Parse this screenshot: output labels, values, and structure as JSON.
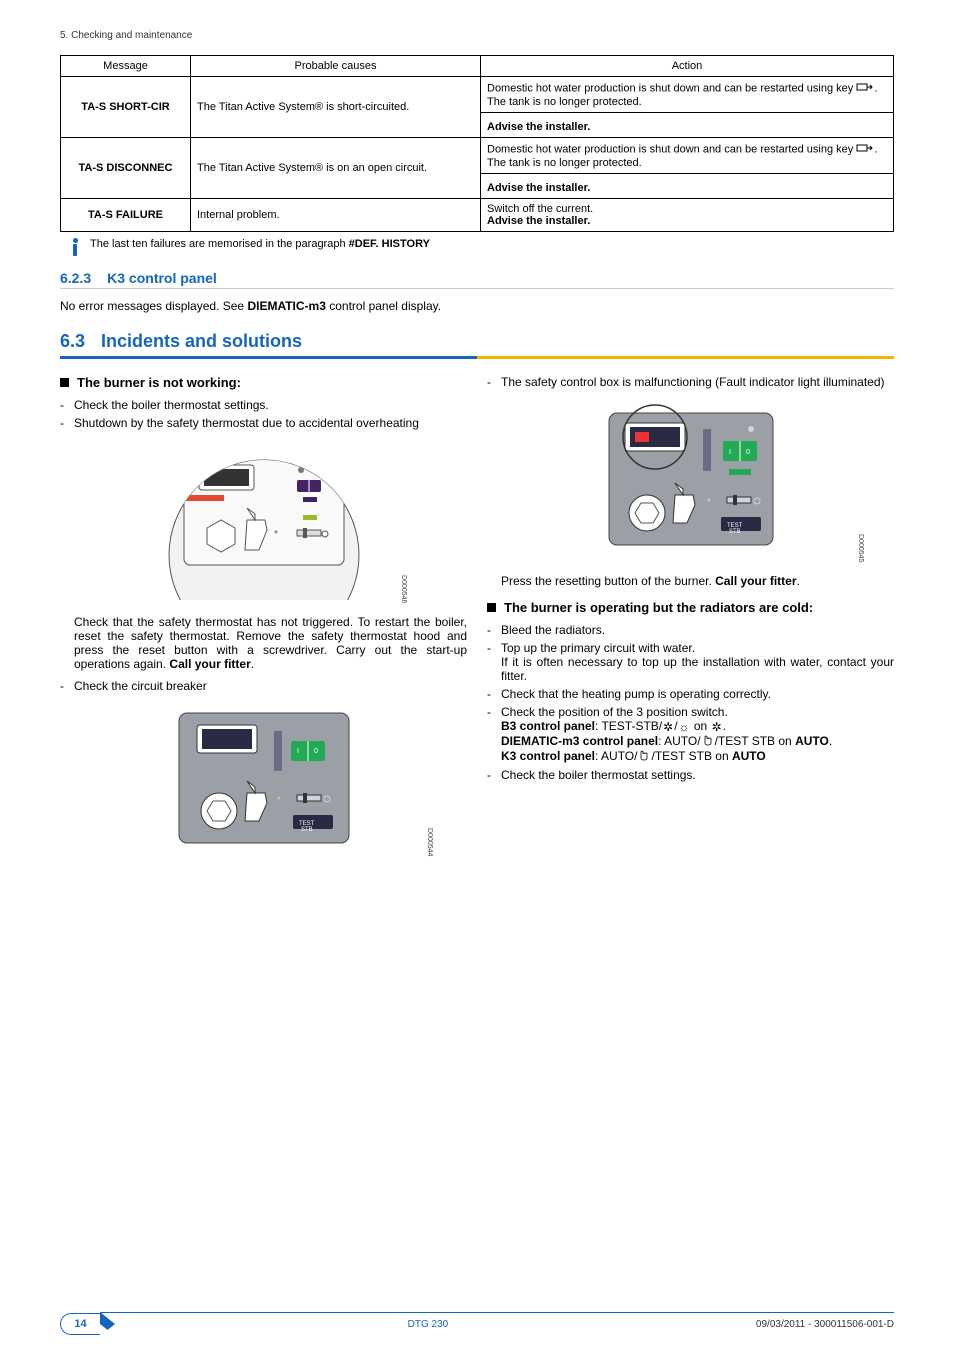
{
  "header": {
    "chapter": "5. Checking and maintenance"
  },
  "table": {
    "headers": {
      "message": "Message",
      "causes": "Probable causes",
      "action": "Action"
    },
    "rows": [
      {
        "msg": "TA-S SHORT-CIR",
        "cause": "The Titan Active System® is short-circuited.",
        "action_pre": "Domestic hot water production is shut down and can be restarted using key ",
        "action_post": ". The tank is no longer protected.",
        "advise": "Advise the installer."
      },
      {
        "msg": "TA-S DISCONNEC",
        "cause": "The Titan Active System® is on an open circuit.",
        "action_pre": "Domestic hot water production is shut down and can be restarted using key ",
        "action_post": ". The tank is no longer protected.",
        "advise": "Advise the installer."
      },
      {
        "msg": "TA-S FAILURE",
        "cause": "Internal problem.",
        "action_line1": "Switch off the current.",
        "advise": "Advise the installer."
      }
    ]
  },
  "info_note": {
    "pre": "The last ten failures are memorised in the paragraph ",
    "bold": "#DEF. HISTORY"
  },
  "sec623": {
    "num": "6.2.3",
    "title": "K3 control panel",
    "body_pre": "No error messages displayed. See ",
    "body_bold": "DIEMATIC-m3",
    "body_post": " control panel display."
  },
  "sec63": {
    "num": "6.3",
    "title": "Incidents and solutions"
  },
  "left": {
    "h": "The burner is not working:",
    "li1": "Check the boiler thermostat settings.",
    "li2": "Shutdown by the safety thermostat due to accidental overheating",
    "fig1_id": "D000546",
    "para": "Check that the safety thermostat has not triggered. To restart the boiler, reset the safety thermostat. Remove the safety thermostat hood and press the reset button with a screwdriver. Carry out the start-up operations again. ",
    "para_bold": "Call your fitter",
    "li3": "Check the circuit breaker",
    "fig2_id": "D000544"
  },
  "right": {
    "li0": "The safety control box is malfunctioning (Fault indicator light illuminated)",
    "fig_id": "D000545",
    "press_reset_pre": "Press the resetting button of the burner. ",
    "press_reset_bold": "Call your fitter",
    "h2": "The burner is operating but the radiators are cold:",
    "li1": "Bleed the radiators.",
    "li2": "Top up the primary circuit with water.",
    "li2b": "If it is often necessary to top up the installation with water, contact your fitter.",
    "li3": "Check that the heating pump is operating correctly.",
    "li4": "Check the position of the 3 position switch.",
    "b3_bold": "B3 control panel",
    "b3_text": ": TEST-STB/",
    "b3_on": " on ",
    "dm_bold": "DIEMATIC-m3 control panel",
    "dm_text": ": AUTO/",
    "dm_end": "/TEST STB on ",
    "dm_auto": "AUTO",
    "k3_bold": "K3 control panel",
    "k3_text": ": AUTO/",
    "k3_end": "/TEST STB on ",
    "k3_auto": "AUTO",
    "li5": "Check the boiler thermostat settings."
  },
  "footer": {
    "page": "14",
    "model": "DTG 230",
    "docref": "09/03/2011 - 300011506-001-D"
  }
}
